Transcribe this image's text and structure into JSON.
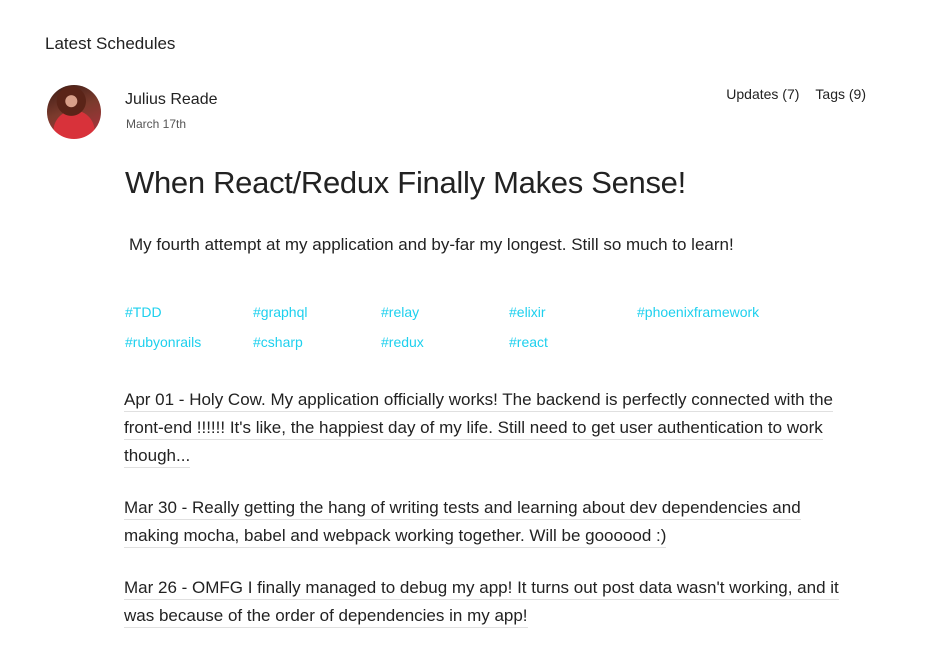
{
  "section_title": "Latest Schedules",
  "post": {
    "author": "Julius Reade",
    "date": "March 17th",
    "updates_link": "Updates (7)",
    "tags_link": "Tags (9)",
    "title": "When React/Redux Finally Makes Sense!",
    "description": "My fourth attempt at my application and by-far my longest. Still so much to learn!",
    "tags": [
      "#TDD",
      "#graphql",
      "#relay",
      "#elixir",
      "#phoenixframework",
      "#rubyonrails",
      "#csharp",
      "#redux",
      "#react"
    ],
    "updates": [
      "Apr 01 - Holy Cow. My application officially works! The backend is perfectly connected with the front-end !!!!!! It's like, the happiest day of my life. Still need to get user authentication to work though...",
      "Mar 30 - Really getting the hang of writing tests and learning about dev dependencies and making mocha, babel and webpack working together. Will be goooood :)",
      "Mar 26 - OMFG I finally managed to debug my app! It turns out post data wasn't working, and it was because of the order of dependencies in my app!"
    ]
  },
  "colors": {
    "tag": "#1ed0ee",
    "text": "#222222",
    "underline": "#e0e0e0"
  }
}
